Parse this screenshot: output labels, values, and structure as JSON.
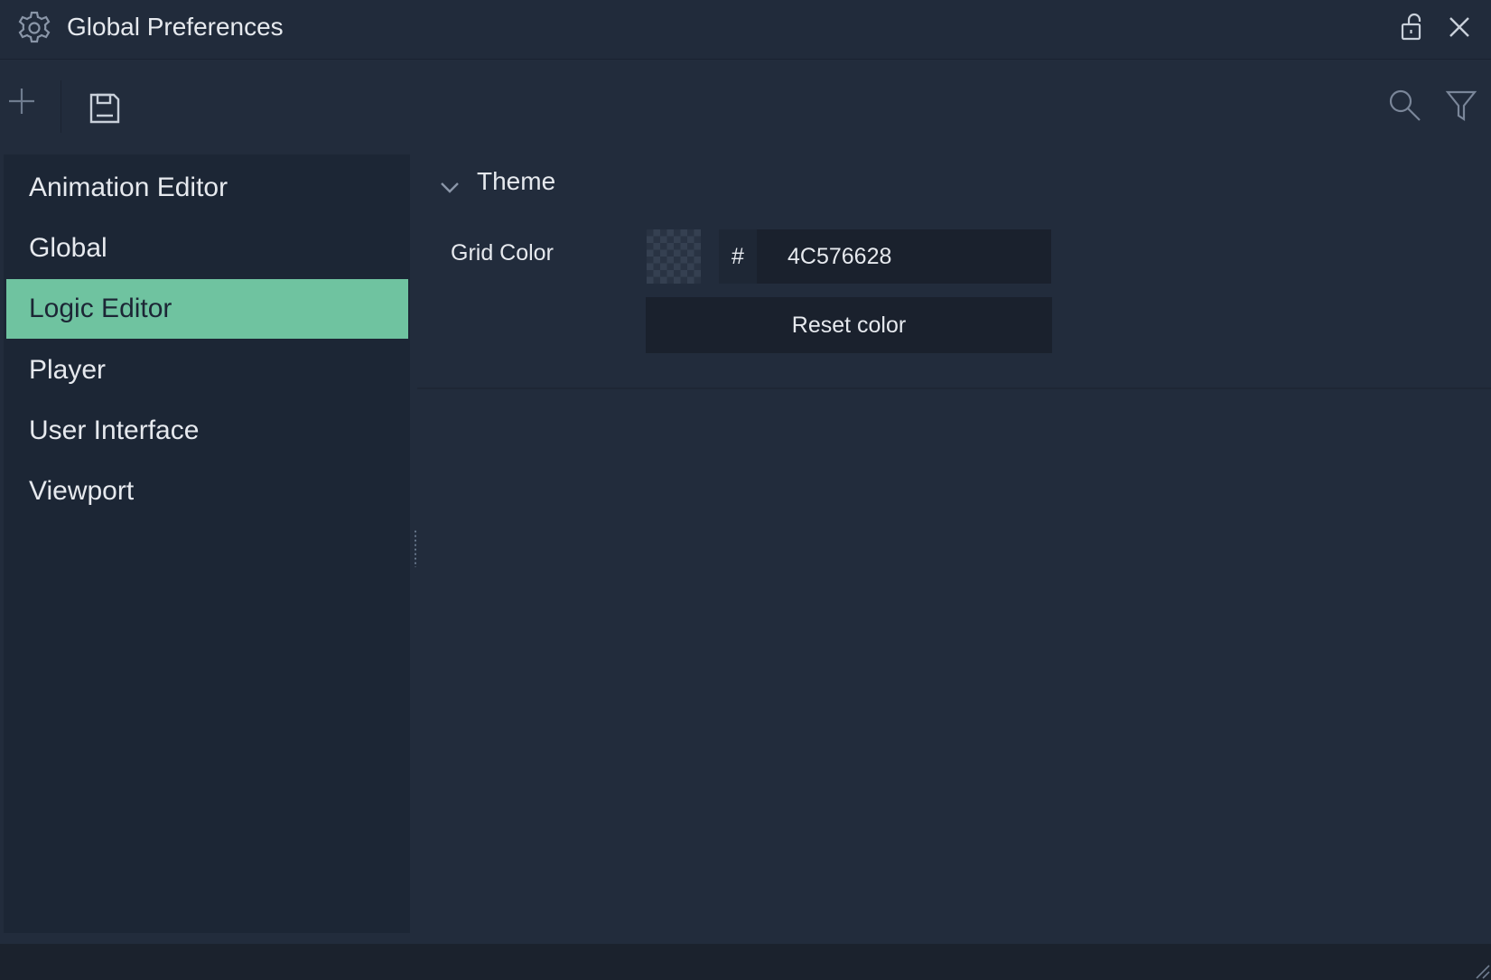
{
  "window": {
    "title": "Global Preferences",
    "icons": {
      "title": "gear-icon",
      "lock": "unlock-icon",
      "close": "close-icon"
    }
  },
  "toolbar": {
    "icons": {
      "add": "plus-icon",
      "save": "save-icon",
      "search": "search-icon",
      "filter": "filter-icon"
    }
  },
  "sidebar": {
    "selected_index": 2,
    "accent_color": "#6fc3a0",
    "items": [
      {
        "label": "Animation Editor"
      },
      {
        "label": "Global"
      },
      {
        "label": "Logic Editor"
      },
      {
        "label": "Player"
      },
      {
        "label": "User Interface"
      },
      {
        "label": "Viewport"
      }
    ]
  },
  "content": {
    "section": {
      "title": "Theme",
      "expanded": true,
      "toggle_icon": "chevron-down-icon"
    },
    "grid_color": {
      "label": "Grid Color",
      "hash": "#",
      "value": "4C576628",
      "reset_label": "Reset color"
    }
  }
}
